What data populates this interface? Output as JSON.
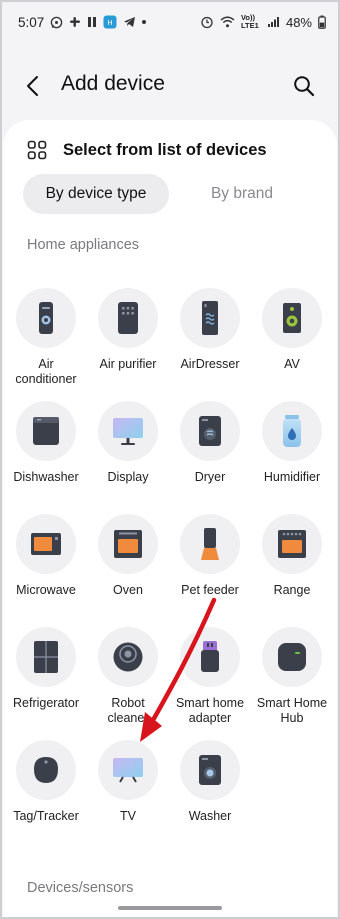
{
  "status_bar": {
    "time": "5:07",
    "battery": "48%",
    "network": "Vo)) LTE1",
    "colors": {
      "text": "#222222"
    }
  },
  "header": {
    "title": "Add device"
  },
  "select": {
    "label": "Select from list of devices"
  },
  "tabs": {
    "by_type": "By device type",
    "by_brand": "By brand",
    "active": "By device type"
  },
  "sections": {
    "home_appliances": "Home appliances",
    "devices_sensors": "Devices/sensors"
  },
  "devices": [
    {
      "label": "Air\nconditioner",
      "icon": "air-conditioner-icon"
    },
    {
      "label": "Air purifier",
      "icon": "air-purifier-icon"
    },
    {
      "label": "AirDresser",
      "icon": "airdresser-icon"
    },
    {
      "label": "AV",
      "icon": "av-speaker-icon"
    },
    {
      "label": "Dishwasher",
      "icon": "dishwasher-icon"
    },
    {
      "label": "Display",
      "icon": "display-icon"
    },
    {
      "label": "Dryer",
      "icon": "dryer-icon"
    },
    {
      "label": "Humidifier",
      "icon": "humidifier-icon"
    },
    {
      "label": "Microwave",
      "icon": "microwave-icon"
    },
    {
      "label": "Oven",
      "icon": "oven-icon"
    },
    {
      "label": "Pet feeder",
      "icon": "pet-feeder-icon"
    },
    {
      "label": "Range",
      "icon": "range-icon"
    },
    {
      "label": "Refrigerator",
      "icon": "refrigerator-icon"
    },
    {
      "label": "Robot\ncleaner",
      "icon": "robot-cleaner-icon"
    },
    {
      "label": "Smart home\nadapter",
      "icon": "smart-home-adapter-icon"
    },
    {
      "label": "Smart Home\nHub",
      "icon": "smart-home-hub-icon"
    },
    {
      "label": "Tag/Tracker",
      "icon": "tag-tracker-icon"
    },
    {
      "label": "TV",
      "icon": "tv-icon"
    },
    {
      "label": "Washer",
      "icon": "washer-icon"
    }
  ],
  "colors": {
    "background": "#f4f4f6",
    "card": "#ffffff",
    "icon_circle": "#f0f0f2",
    "icon_dark": "#3a3f4a",
    "accent_orange": "#f08a3c",
    "annotation_arrow": "#d8141c"
  }
}
